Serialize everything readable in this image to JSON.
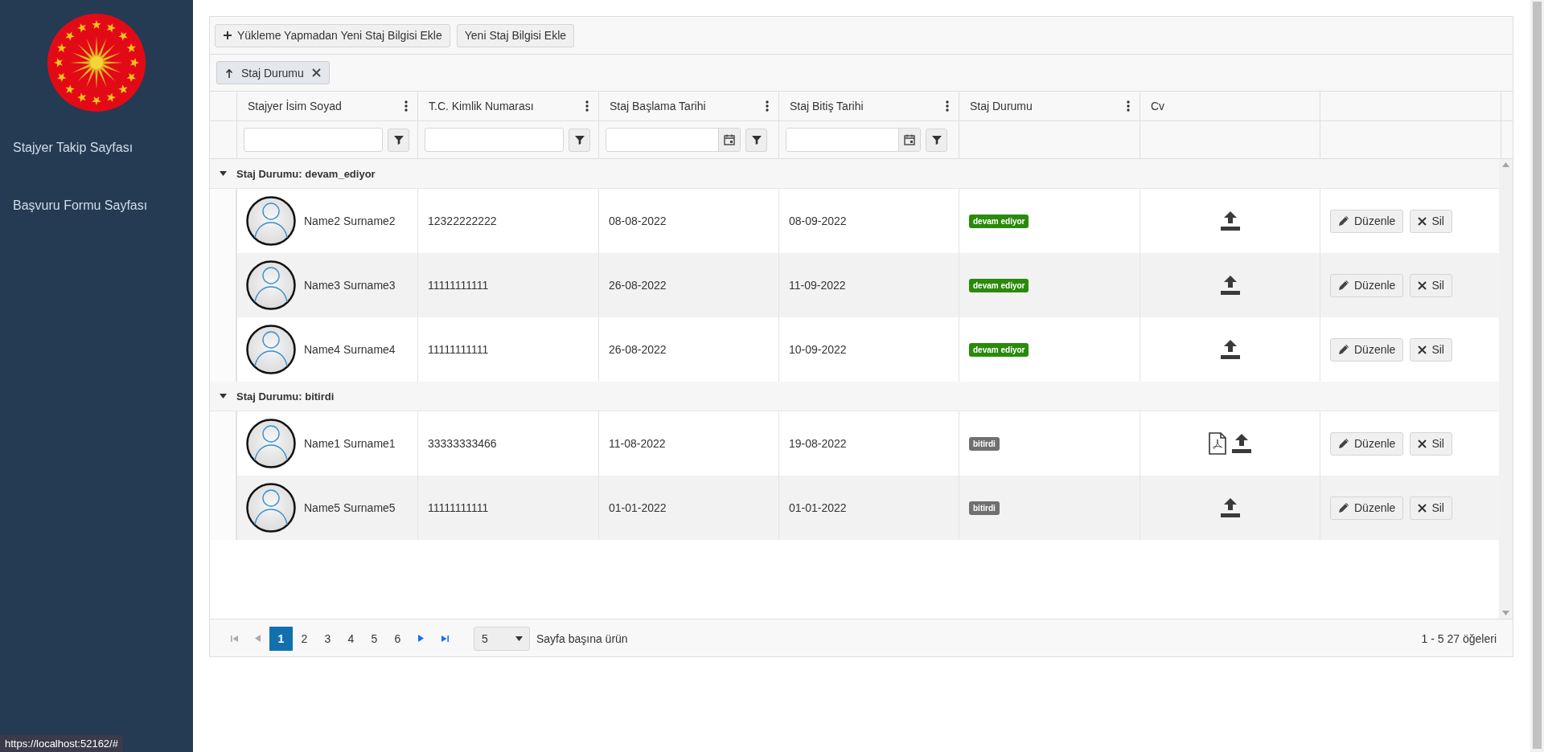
{
  "sidebar": {
    "items": [
      {
        "label": "Stajyer Takip Sayfası"
      },
      {
        "label": "Başvuru Formu Sayfası"
      }
    ]
  },
  "toolbar": {
    "buttons": [
      {
        "label": "Yükleme Yapmadan Yeni Staj Bilgisi Ekle",
        "kind": "add"
      },
      {
        "label": "Yeni Staj Bilgisi Ekle",
        "kind": "plain"
      }
    ]
  },
  "grouping": {
    "chips": [
      {
        "label": "Staj Durumu"
      }
    ]
  },
  "table": {
    "columns": [
      {
        "label": "Stajyer İsim Soyad",
        "menu": true,
        "kind": "text"
      },
      {
        "label": "T.C. Kimlik Numarası",
        "menu": true,
        "kind": "text"
      },
      {
        "label": "Staj Başlama Tarihi",
        "menu": true,
        "kind": "date"
      },
      {
        "label": "Staj Bitiş Tarihi",
        "menu": true,
        "kind": "date"
      },
      {
        "label": "Staj Durumu",
        "menu": true,
        "kind": "plain"
      },
      {
        "label": "Cv",
        "menu": false,
        "kind": "plain"
      }
    ],
    "groups": [
      {
        "title": "Staj Durumu: devam_ediyor",
        "expanded": true,
        "rows": [
          {
            "name": "Name2 Surname2",
            "tc": "12322222222",
            "start": "08-08-2022",
            "end": "08-09-2022",
            "status": {
              "label": "devam ediyor",
              "color": "#2a8a0a"
            },
            "cv_pdf": false,
            "actions": [
              "Düzenle",
              "Sil"
            ]
          },
          {
            "name": "Name3 Surname3",
            "tc": "11111111111",
            "start": "26-08-2022",
            "end": "11-09-2022",
            "status": {
              "label": "devam ediyor",
              "color": "#2a8a0a"
            },
            "cv_pdf": false,
            "actions": [
              "Düzenle",
              "Sil"
            ]
          },
          {
            "name": "Name4 Surname4",
            "tc": "11111111111",
            "start": "26-08-2022",
            "end": "10-09-2022",
            "status": {
              "label": "devam ediyor",
              "color": "#2a8a0a"
            },
            "cv_pdf": false,
            "actions": [
              "Düzenle",
              "Sil"
            ]
          }
        ]
      },
      {
        "title": "Staj Durumu: bitirdi",
        "expanded": true,
        "rows": [
          {
            "name": "Name1 Surname1",
            "tc": "33333333466",
            "start": "11-08-2022",
            "end": "19-08-2022",
            "status": {
              "label": "bitirdi",
              "color": "#707070"
            },
            "cv_pdf": true,
            "actions": [
              "Düzenle",
              "Sil"
            ]
          },
          {
            "name": "Name5 Surname5",
            "tc": "11111111111",
            "start": "01-01-2022",
            "end": "01-01-2022",
            "status": {
              "label": "bitirdi",
              "color": "#707070"
            },
            "cv_pdf": false,
            "actions": [
              "Düzenle",
              "Sil"
            ]
          }
        ]
      }
    ]
  },
  "pager": {
    "pages": [
      {
        "label": "1",
        "selected": true
      },
      {
        "label": "2",
        "selected": false
      },
      {
        "label": "3",
        "selected": false
      },
      {
        "label": "4",
        "selected": false
      },
      {
        "label": "5",
        "selected": false
      },
      {
        "label": "6",
        "selected": false
      }
    ],
    "page_size": "5",
    "page_size_label": "Sayfa başına ürün",
    "info": "1 - 5 27 öğeleri"
  },
  "status_url": "https://localhost:52162/#"
}
